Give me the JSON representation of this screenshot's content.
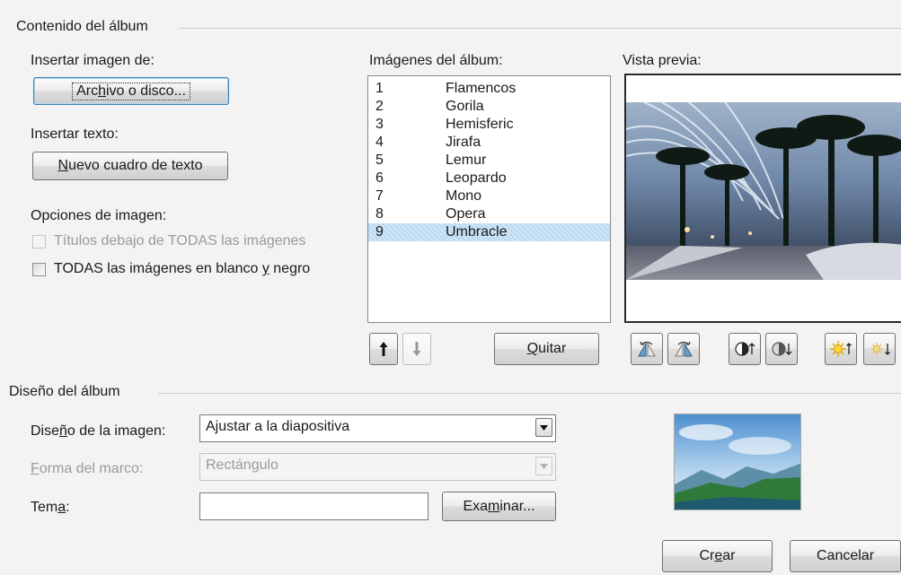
{
  "album_content": {
    "title": "Contenido del álbum",
    "insert_image_label": "Insertar imagen de:",
    "file_button": {
      "pre": "Arc",
      "key": "h",
      "post": "ivo o disco..."
    },
    "insert_text_label": "Insertar texto:",
    "new_textbox_button": {
      "pre": "",
      "key": "N",
      "post": "uevo cuadro de texto"
    },
    "image_options_label": "Opciones de imagen:",
    "captions_option": {
      "label": "Títulos debajo de TODAS las imágenes",
      "checked": false,
      "enabled": false
    },
    "bw_option": {
      "pre": "TODAS las imágenes en blanco ",
      "key": "y",
      "post": " negro",
      "checked": false,
      "enabled": true
    },
    "album_images_label": "Imágenes del álbum:",
    "images": [
      {
        "num": "1",
        "name": "Flamencos"
      },
      {
        "num": "2",
        "name": "Gorila"
      },
      {
        "num": "3",
        "name": "Hemisferic"
      },
      {
        "num": "4",
        "name": "Jirafa"
      },
      {
        "num": "5",
        "name": "Lemur"
      },
      {
        "num": "6",
        "name": "Leopardo"
      },
      {
        "num": "7",
        "name": "Mono"
      },
      {
        "num": "8",
        "name": "Opera"
      },
      {
        "num": "9",
        "name": "Umbracle"
      }
    ],
    "selected_index": 8,
    "move_up_icon": "arrow-up-icon",
    "move_down_icon": "arrow-down-icon",
    "remove_button": {
      "pre": "",
      "key": "Q",
      "post": "uitar"
    },
    "preview_label": "Vista previa:",
    "preview_tools": [
      "rotate-left-icon",
      "rotate-right-icon",
      "contrast-up-icon",
      "contrast-down-icon",
      "brightness-up-icon",
      "brightness-down-icon"
    ]
  },
  "album_layout": {
    "title": "Diseño del álbum",
    "picture_layout_label": {
      "pre": "Dise",
      "key": "ñ",
      "post": "o de la imagen:"
    },
    "picture_layout_value": "Ajustar a la diapositiva",
    "frame_shape_label": {
      "pre": "",
      "key": "F",
      "post": "orma del marco:"
    },
    "frame_shape_value": "Rectángulo",
    "theme_label": {
      "pre": "Tem",
      "key": "a",
      "post": ":"
    },
    "theme_value": "",
    "browse_button": {
      "pre": "Exa",
      "key": "m",
      "post": "inar..."
    }
  },
  "footer": {
    "create_button": {
      "pre": "Cr",
      "key": "e",
      "post": "ar"
    },
    "cancel_button": "Cancelar"
  },
  "colors": {
    "dialog_bg": "#f3f3f3",
    "selection": "#cfe6f7",
    "focus_border": "#3c7fb1"
  }
}
